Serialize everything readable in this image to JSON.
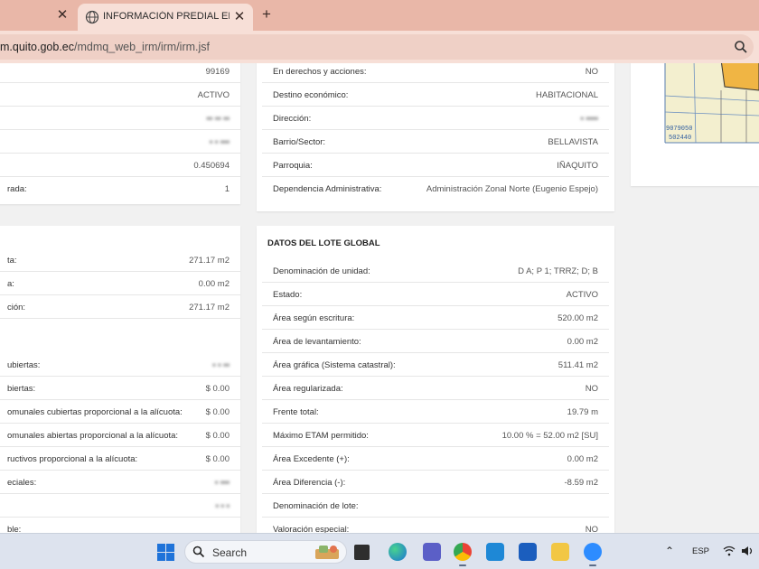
{
  "browser": {
    "active_tab_title": "INFORMACIÓN PREDIAL EN UN",
    "url_host": "m.quito.gob.ec",
    "url_path": "/mdmq_web_irm/irm/irm.jsf"
  },
  "left_top": {
    "rows": [
      {
        "label": "",
        "value": "99169"
      },
      {
        "label": "",
        "value": "ACTIVO"
      },
      {
        "label": "",
        "value": "▪▪ ▪▪ ▪▪"
      },
      {
        "label": "",
        "value": "▪ ▪ ▪▪▪"
      },
      {
        "label": "",
        "value": "0.450694"
      },
      {
        "label": "rada:",
        "value": "1"
      }
    ]
  },
  "mid_top": {
    "rows": [
      {
        "label": "En derechos y acciones:",
        "value": "NO"
      },
      {
        "label": "Destino económico:",
        "value": "HABITACIONAL"
      },
      {
        "label": "Dirección:",
        "value": "▪ ▪▪▪▪"
      },
      {
        "label": "Barrio/Sector:",
        "value": "BELLAVISTA"
      },
      {
        "label": "Parroquia:",
        "value": "IÑAQUITO"
      },
      {
        "label": "Dependencia Administrativa:",
        "value": "Administración Zonal Norte (Eugenio Espejo)"
      }
    ]
  },
  "map": {
    "label_1": "9079050",
    "label_2": "502440"
  },
  "left_bottom": {
    "rows": [
      {
        "label": "ta:",
        "value": "271.17 m2"
      },
      {
        "label": "a:",
        "value": "0.00 m2"
      },
      {
        "label": "ción:",
        "value": "271.17 m2"
      },
      {
        "label": "",
        "value": ""
      },
      {
        "label": "ubiertas:",
        "value": "▪ ▪ ▪▪"
      },
      {
        "label": "biertas:",
        "value": "$ 0.00"
      },
      {
        "label": "omunales cubiertas proporcional a la alícuota:",
        "value": "$ 0.00"
      },
      {
        "label": "omunales abiertas proporcional a la alícuota:",
        "value": "$ 0.00"
      },
      {
        "label": "ructivos proporcional a la alícuota:",
        "value": "$ 0.00"
      },
      {
        "label": "eciales:",
        "value": "▪ ▪▪▪"
      },
      {
        "label": "",
        "value": "▪ ▪ ▪"
      },
      {
        "label": "ble:",
        "value": ""
      }
    ]
  },
  "lote_global": {
    "title": "DATOS DEL LOTE GLOBAL",
    "rows": [
      {
        "label": "Denominación de unidad:",
        "value": "D A; P 1; TRRZ; D; B"
      },
      {
        "label": "Estado:",
        "value": "ACTIVO"
      },
      {
        "label": "Área según escritura:",
        "value": "520.00 m2"
      },
      {
        "label": "Área de levantamiento:",
        "value": "0.00 m2"
      },
      {
        "label": "Área gráfica (Sistema catastral):",
        "value": "511.41 m2"
      },
      {
        "label": "Área regularizada:",
        "value": "NO"
      },
      {
        "label": "Frente total:",
        "value": "19.79 m"
      },
      {
        "label": "Máximo ETAM permitido:",
        "value": "10.00 % = 52.00 m2 [SU]"
      },
      {
        "label": "Área Excedente (+):",
        "value": "0.00 m2"
      },
      {
        "label": "Área Diferencia (-):",
        "value": "-8.59 m2"
      },
      {
        "label": "Denominación de lote:",
        "value": ""
      },
      {
        "label": "Valoración especial:",
        "value": "NO"
      }
    ]
  },
  "taskbar": {
    "search_label": "Search",
    "lang": "ESP",
    "apps": [
      "file-explorer-icon",
      "edge-icon",
      "teams-icon",
      "chrome-icon",
      "photos-icon",
      "word-icon",
      "folder-icon",
      "zoom-icon"
    ]
  }
}
